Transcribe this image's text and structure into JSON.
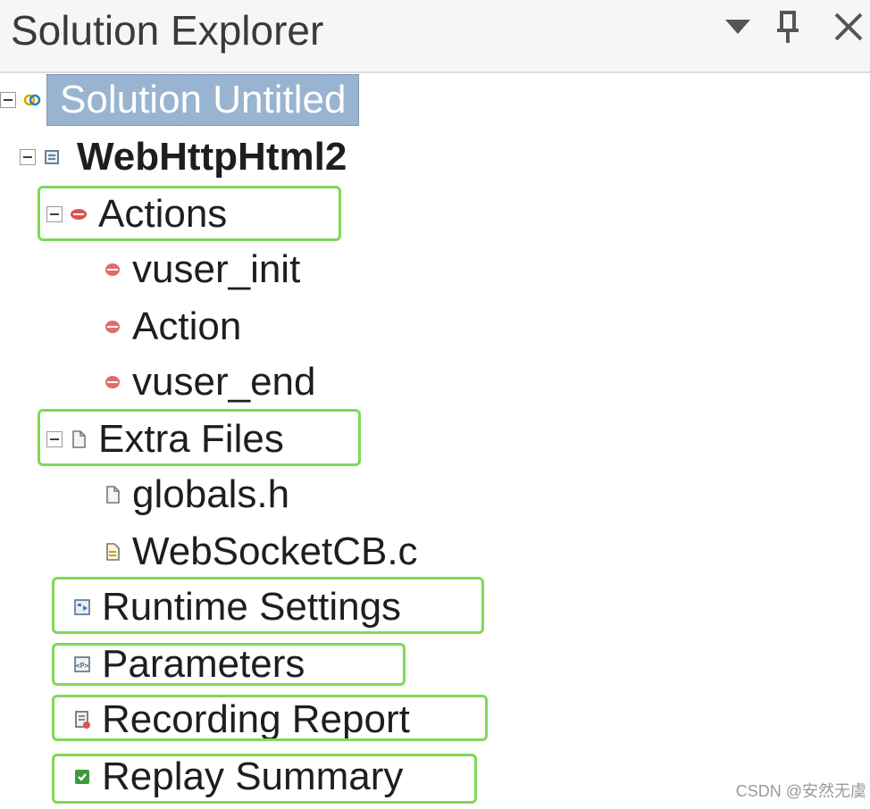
{
  "panel": {
    "title": "Solution Explorer",
    "buttons": [
      {
        "name": "dropdown",
        "icon": "chevron-down-icon"
      },
      {
        "name": "pin",
        "icon": "pin-icon"
      },
      {
        "name": "close",
        "icon": "close-icon"
      }
    ]
  },
  "tree": {
    "solution": {
      "label": "Solution Untitled",
      "icon": "solution-icon",
      "selected": true
    },
    "script": {
      "label": "WebHttpHtml2",
      "icon": "script-icon"
    },
    "actions": {
      "label": "Actions",
      "icon": "actions-icon",
      "children": [
        "vuser_init",
        "Action",
        "vuser_end"
      ]
    },
    "extra_files": {
      "label": "Extra Files",
      "icon": "file-icon",
      "children": [
        "globals.h",
        "WebSocketCB.c"
      ]
    },
    "runtime_settings": {
      "label": "Runtime Settings",
      "icon": "runtime-settings-icon"
    },
    "parameters": {
      "label": "Parameters",
      "icon": "parameters-icon"
    },
    "recording_report": {
      "label": "Recording Report",
      "icon": "recording-report-icon"
    },
    "replay_summary": {
      "label": "Replay Summary",
      "icon": "replay-summary-icon"
    }
  },
  "highlight_color": "#7ed957",
  "watermark": "CSDN @安然无虞"
}
